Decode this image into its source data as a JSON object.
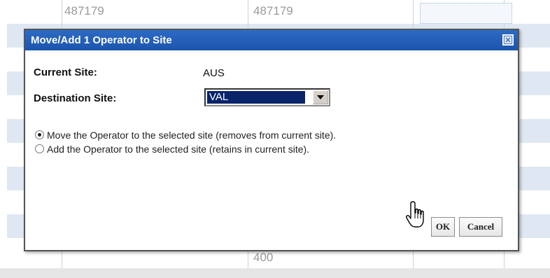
{
  "background_table": {
    "cell_top_left": "487179",
    "cell_top_mid": "487179",
    "cell_bottom_mid": "400"
  },
  "dialog": {
    "title": "Move/Add 1 Operator to Site",
    "current_site_label": "Current Site:",
    "current_site_value": "AUS",
    "destination_site_label": "Destination Site:",
    "destination_site_value": "VAL",
    "radio_move_label": "Move the Operator to the selected site (removes from current site).",
    "radio_add_label": "Add the Operator to the selected site (retains in current site).",
    "radio_selected": "move",
    "ok_label": "OK",
    "cancel_label": "Cancel"
  },
  "icons": {
    "close": "close-icon",
    "dropdown": "chevron-down-icon",
    "cursor": "hand-pointer-icon"
  },
  "colors": {
    "titlebar": "#1b54ad",
    "row_alt": "#dfe8f2",
    "selection": "#0a246a"
  }
}
